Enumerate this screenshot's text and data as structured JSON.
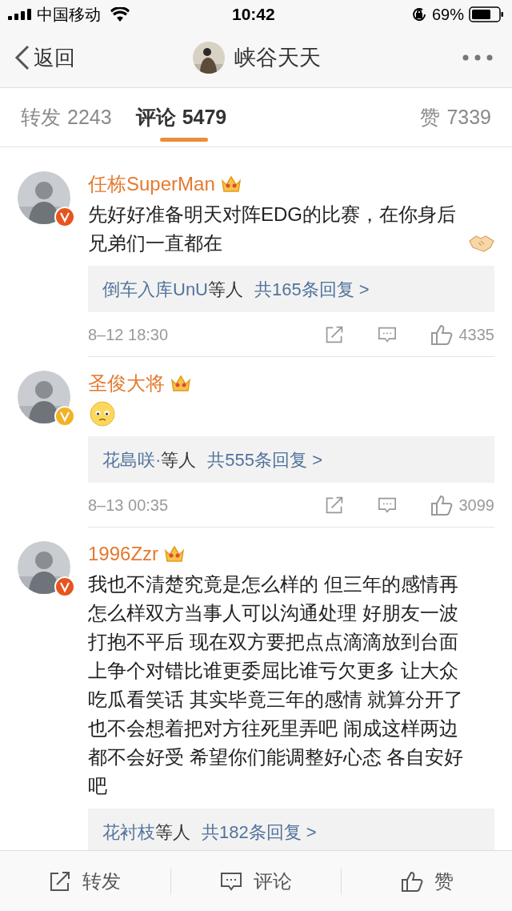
{
  "status_bar": {
    "carrier": "中国移动",
    "time": "10:42",
    "battery": "69%"
  },
  "nav": {
    "back": "返回",
    "title": "峡谷天天"
  },
  "tabs": [
    {
      "label": "转发",
      "count": "2243",
      "selected": false
    },
    {
      "label": "评论",
      "count": "5479",
      "selected": true
    },
    {
      "label": "赞",
      "count": "7339",
      "selected": false
    }
  ],
  "comments": [
    {
      "author": "任栋SuperMan",
      "verified_badge": {
        "color": "#e8541e"
      },
      "text": "先好好准备明天对阵EDG的比赛，在你身后兄弟们一直都在",
      "emoji": {
        "kind": "handshake"
      },
      "reply_names": "倒车入库UnU",
      "reply_suffix": "等人",
      "reply_count": "共165条回复 >",
      "time": "8–12 18:30",
      "likes": "4335"
    },
    {
      "author": "圣俊大将",
      "verified_badge": {
        "color": "#f2b226"
      },
      "emoji": {
        "kind": "worried"
      },
      "reply_names": "花島咲·",
      "reply_suffix": "等人",
      "reply_count": "共555条回复 >",
      "time": "8–13 00:35",
      "likes": "3099"
    },
    {
      "author": "1996Zzr",
      "verified_badge": {
        "color": "#e8541e"
      },
      "text": "我也不清楚究竟是怎么样的 但三年的感情再怎么样双方当事人可以沟通处理 好朋友一波打抱不平后 现在双方要把点点滴滴放到台面上争个对错比谁更委屈比谁亏欠更多 让大众吃瓜看笑话 其实毕竟三年的感情 就算分开了也不会想着把对方往死里弄吧 闹成这样两边都不会好受 希望你们能调整好心态 各自安好吧",
      "reply_names": "花衬枝",
      "reply_suffix": "等人",
      "reply_count": "共182条回复 >"
    }
  ],
  "bottom_bar": [
    {
      "kind": "repost",
      "label": "转发"
    },
    {
      "kind": "comment",
      "label": "评论"
    },
    {
      "kind": "like",
      "label": "赞"
    }
  ]
}
